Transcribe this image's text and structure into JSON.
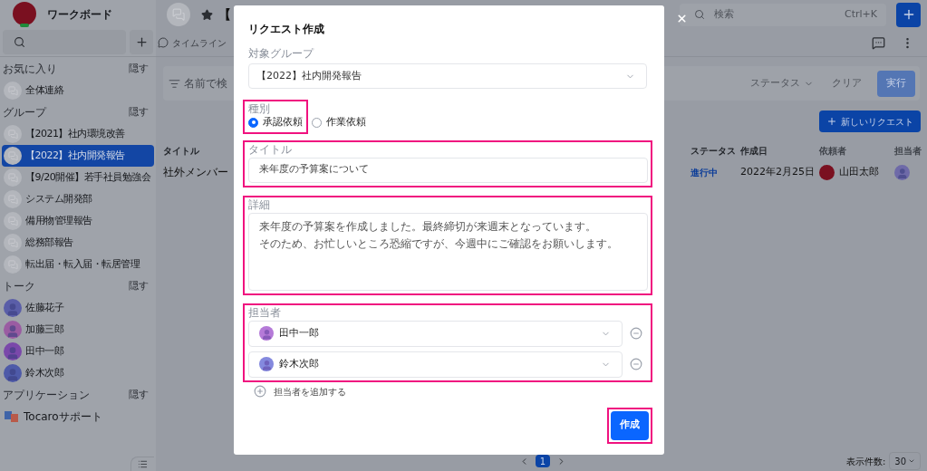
{
  "sidebar": {
    "app_name": "ワークボード",
    "sections": [
      {
        "title": "お気に入り",
        "action": "隠す",
        "items": [
          {
            "kind": "group",
            "label": "全体連絡",
            "selected": false
          }
        ]
      },
      {
        "title": "グループ",
        "action": "隠す",
        "items": [
          {
            "kind": "group",
            "label": "【2021】社内環境改善",
            "selected": false
          },
          {
            "kind": "group",
            "label": "【2022】社内開発報告",
            "selected": true
          },
          {
            "kind": "group",
            "label": "【9/20開催】若手社員勉強会",
            "selected": false
          },
          {
            "kind": "group",
            "label": "システム開発部",
            "selected": false
          },
          {
            "kind": "group",
            "label": "備用物管理報告",
            "selected": false
          },
          {
            "kind": "group",
            "label": "総務部報告",
            "selected": false
          },
          {
            "kind": "group",
            "label": "転出届・転入届・転居管理",
            "selected": false
          }
        ]
      },
      {
        "title": "トーク",
        "action": "隠す",
        "items": [
          {
            "kind": "person",
            "label": "佐藤花子",
            "color": "#5a5ea8",
            "selected": false
          },
          {
            "kind": "person",
            "label": "加藤三郎",
            "color": "#9a5ca2",
            "selected": false
          },
          {
            "kind": "person",
            "label": "田中一郎",
            "color": "#7a48aa",
            "selected": false
          },
          {
            "kind": "person",
            "label": "鈴木次郎",
            "color": "#4e5aa8",
            "selected": false
          }
        ]
      },
      {
        "title": "アプリケーション",
        "action": "隠す",
        "items": [
          {
            "kind": "app",
            "label": "Tocaroサポート",
            "selected": false
          }
        ]
      }
    ]
  },
  "header": {
    "title": "【",
    "tabs": [
      "タイムライン"
    ],
    "search": {
      "placeholder": "検索",
      "shortcut": "Ctrl+K"
    }
  },
  "filter": {
    "placeholder": "名前で検",
    "status": "ステータス",
    "clear": "クリア",
    "run": "実行"
  },
  "new_request_button": "新しいリクエスト",
  "table": {
    "columns": [
      "タイトル",
      "ステータス",
      "作成日",
      "依頼者",
      "担当者"
    ],
    "rows": [
      {
        "title": "社外メンバー",
        "status": "進行中",
        "created": "2022年2月25日",
        "requester": "山田太郎"
      }
    ]
  },
  "pagination": {
    "pages": [
      {
        "label": "1",
        "selected": true
      }
    ]
  },
  "page_size": {
    "label": "表示件数:",
    "value": "30"
  },
  "dialog": {
    "title": "リクエスト作成",
    "group": {
      "label": "対象グループ",
      "value": "【2022】社内開発報告"
    },
    "type": {
      "label": "種別",
      "options": [
        {
          "label": "承認依頼",
          "selected": true
        },
        {
          "label": "作業依頼",
          "selected": false
        }
      ]
    },
    "request_title": {
      "label": "タイトル",
      "value": "来年度の予算案について"
    },
    "details": {
      "label": "詳細",
      "lines": [
        "来年度の予算案を作成しました。最終締切が来週末となっています。",
        "そのため、お忙しいところ恐縮ですが、今週中にご確認をお願いします。"
      ]
    },
    "assignees": {
      "label": "担当者",
      "people": [
        {
          "name": "田中一郎",
          "color": "#b57ad8"
        },
        {
          "name": "鈴木次郎",
          "color": "#8489de"
        }
      ],
      "add": "担当者を追加する"
    },
    "submit": "作成"
  }
}
